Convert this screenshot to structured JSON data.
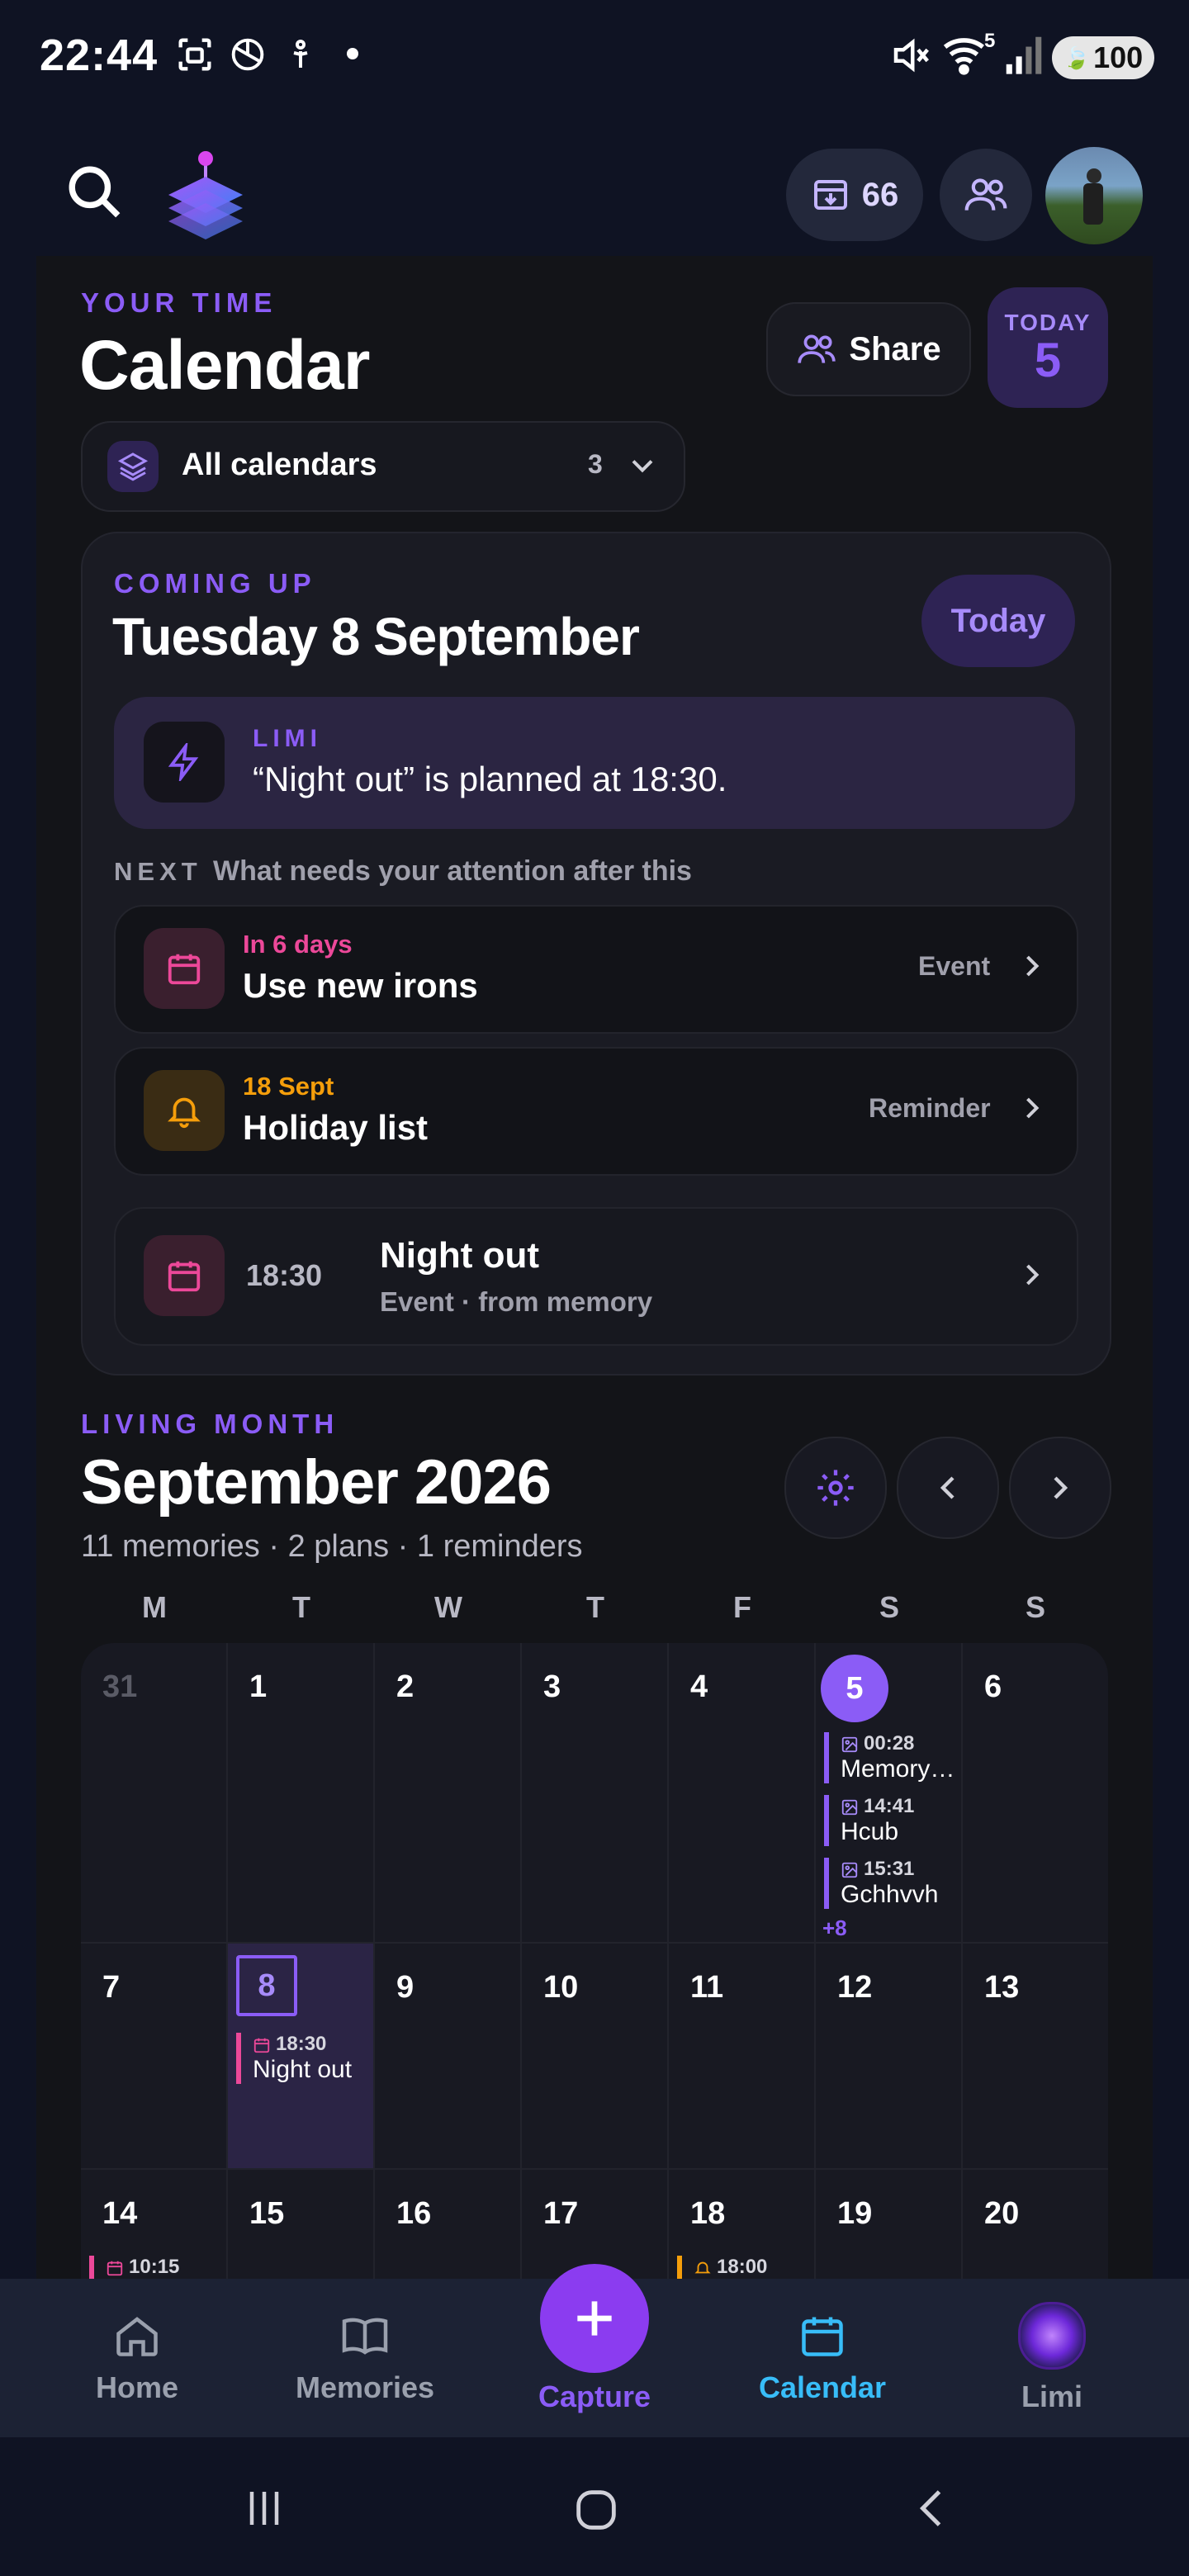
{
  "status_bar": {
    "time": "22:44",
    "battery": "100",
    "wifi_badge": "5"
  },
  "header": {
    "inbox_count": "66",
    "icons": [
      "search-icon",
      "app-logo",
      "inbox-icon",
      "people-icon",
      "avatar"
    ]
  },
  "page": {
    "eyebrow": "YOUR TIME",
    "title": "Calendar",
    "share_label": "Share",
    "today_label": "TODAY",
    "today_number": "5"
  },
  "calendar_selector": {
    "label": "All calendars",
    "count": "3"
  },
  "coming_up": {
    "eyebrow": "COMING UP",
    "date": "Tuesday 8 September",
    "today_button": "Today",
    "limi": {
      "label": "LIMI",
      "message": "“Night out” is planned at 18:30."
    },
    "next_label": "NEXT",
    "next_hint": "What needs your attention after this",
    "items": [
      {
        "when": "In 6 days",
        "title": "Use new irons",
        "kind": "Event",
        "icon": "calendar-icon",
        "accent": "#ec4899"
      },
      {
        "when": "18 Sept",
        "title": "Holiday list",
        "kind": "Reminder",
        "icon": "bell-icon",
        "accent": "#f59e0b"
      }
    ],
    "featured": {
      "time": "18:30",
      "title": "Night out",
      "subtitle": "Event · from memory"
    }
  },
  "living_month": {
    "eyebrow": "LIVING MONTH",
    "title": "September 2026",
    "summary": "11 memories · 2 plans · 1 reminders",
    "weekdays": [
      "M",
      "T",
      "W",
      "T",
      "F",
      "S",
      "S"
    ],
    "week1": [
      "31",
      "1",
      "2",
      "3",
      "4",
      "5",
      "6"
    ],
    "week2": [
      "7",
      "8",
      "9",
      "10",
      "11",
      "12",
      "13"
    ],
    "week3": [
      "14",
      "15",
      "16",
      "17",
      "18",
      "19",
      "20"
    ],
    "sat5_events": [
      {
        "time": "00:28",
        "name": "Memory ..."
      },
      {
        "time": "14:41",
        "name": "Hcub"
      },
      {
        "time": "15:31",
        "name": "Gchhvvh"
      }
    ],
    "sat5_more": "+8",
    "tue8_event": {
      "time": "18:30",
      "name": "Night out"
    },
    "mon14_event_time": "10:15",
    "fri18_event_time": "18:00"
  },
  "colors": {
    "accent": "#8b5cf6",
    "calendar_active": "#38bdf8",
    "pink": "#ec4899",
    "amber": "#f59e0b"
  },
  "bottom_nav": {
    "home": "Home",
    "memories": "Memories",
    "capture": "Capture",
    "calendar": "Calendar",
    "limi": "Limi"
  }
}
